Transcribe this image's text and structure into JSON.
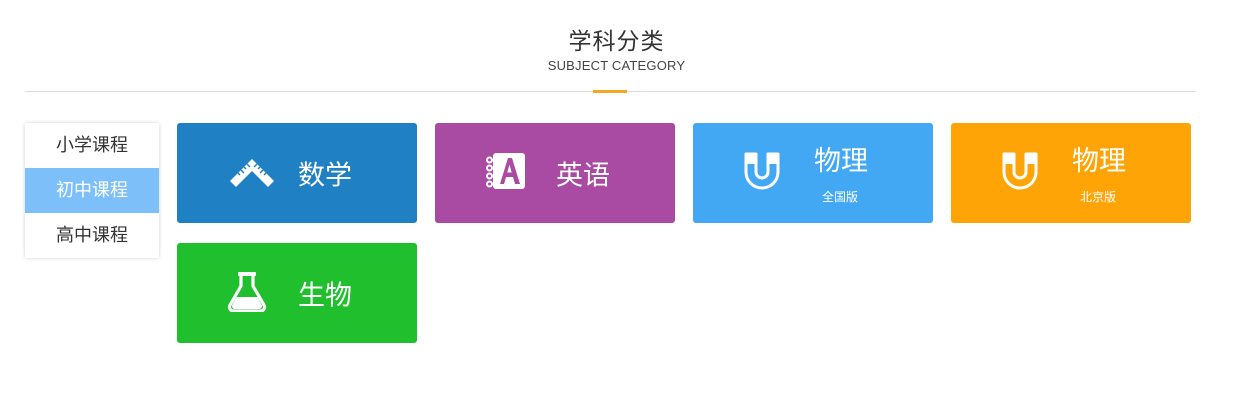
{
  "header": {
    "title": "学科分类",
    "subtitle": "SUBJECT CATEGORY",
    "accent_color": "#f5a623"
  },
  "sidebar": {
    "items": [
      {
        "label": "小学课程",
        "active": false
      },
      {
        "label": "初中课程",
        "active": true
      },
      {
        "label": "高中课程",
        "active": false
      }
    ],
    "active_color": "#7dbff8"
  },
  "subjects": [
    {
      "name": "数学",
      "edition": "",
      "icon": "ruler-icon",
      "color": "#1f80c3"
    },
    {
      "name": "英语",
      "edition": "",
      "icon": "notebook-a-icon",
      "color": "#a94aa3"
    },
    {
      "name": "物理",
      "edition": "全国版",
      "icon": "magnet-icon",
      "color": "#42a8f3"
    },
    {
      "name": "物理",
      "edition": "北京版",
      "icon": "magnet-icon",
      "color": "#ffa407"
    },
    {
      "name": "生物",
      "edition": "",
      "icon": "flask-icon",
      "color": "#1fbf2e"
    }
  ]
}
